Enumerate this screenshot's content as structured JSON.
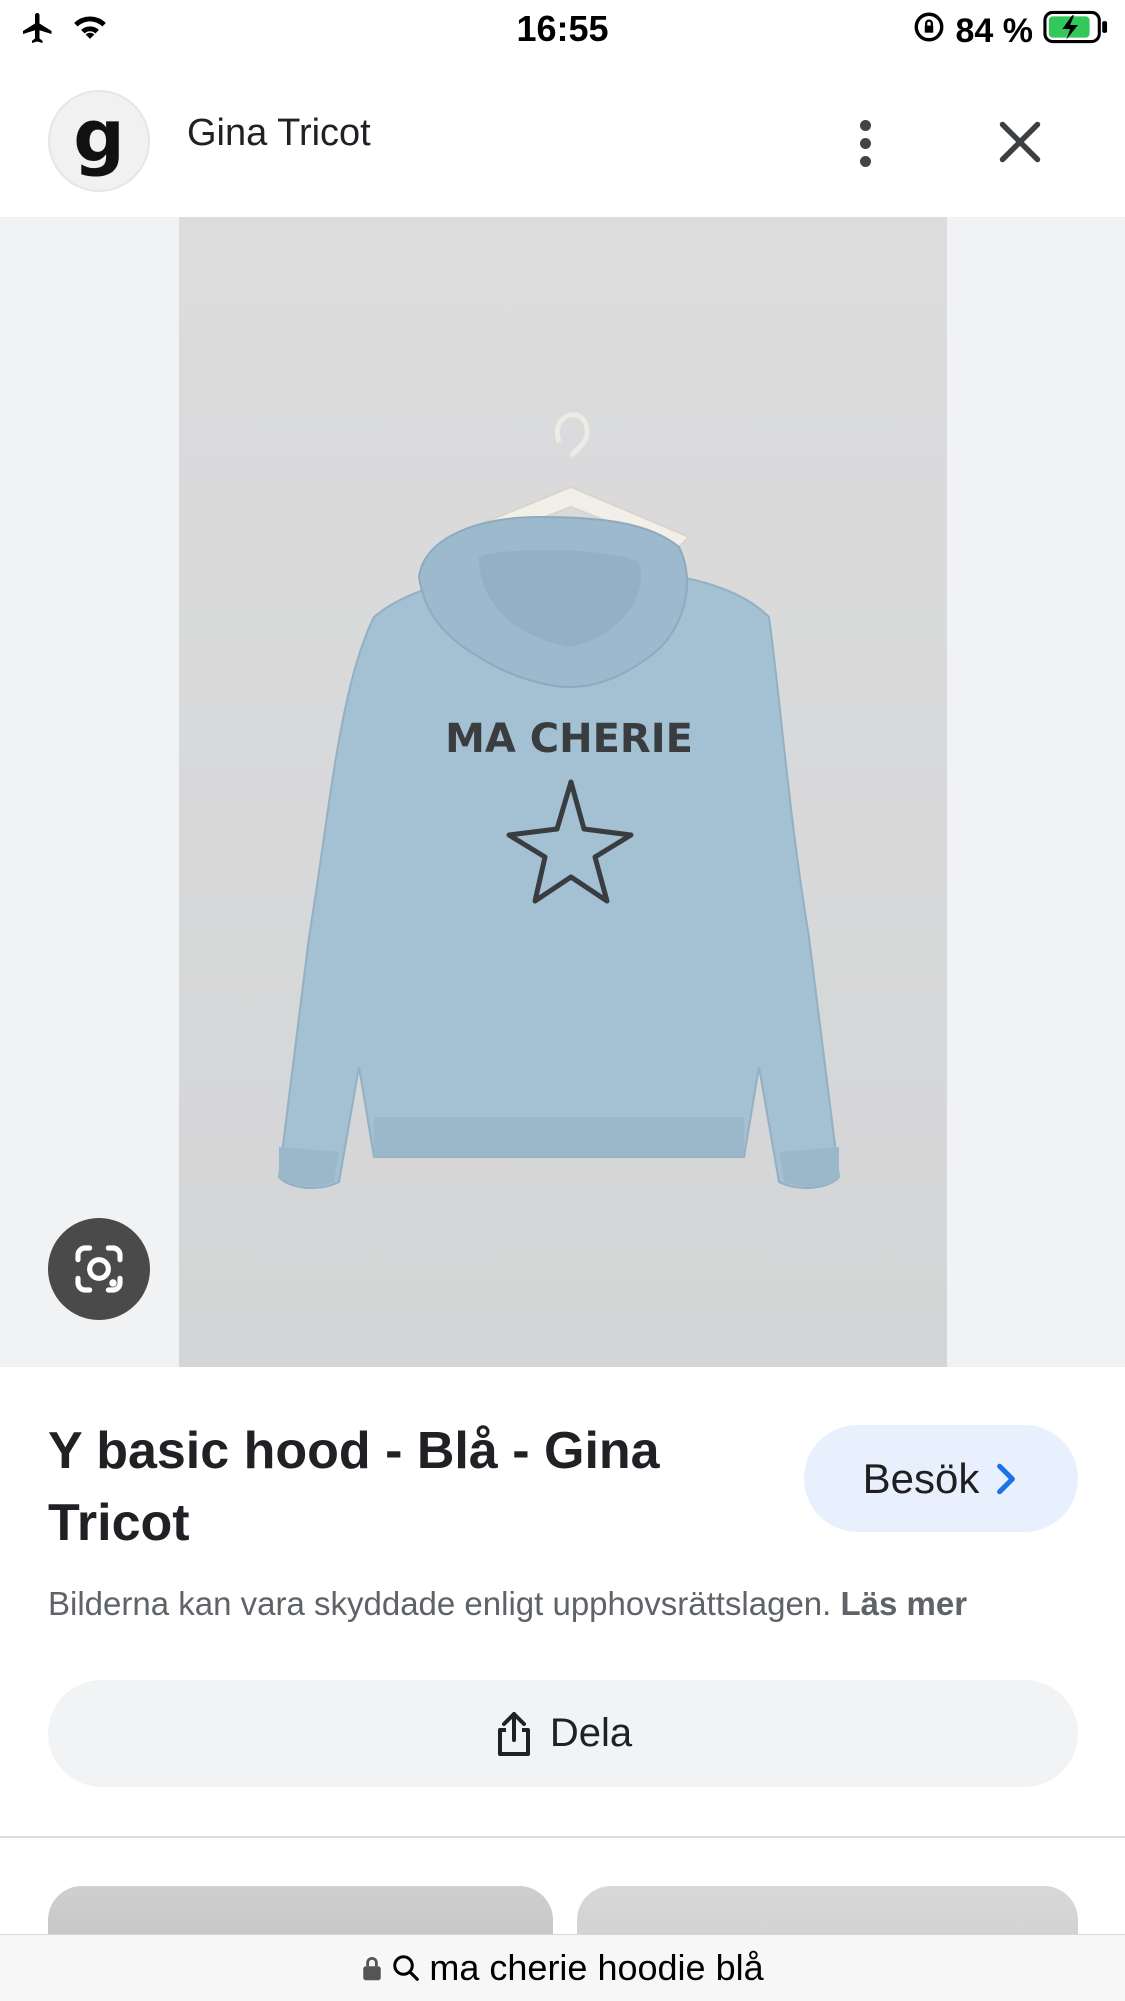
{
  "status_bar": {
    "time": "16:55",
    "battery": "84 %"
  },
  "header": {
    "logo_letter": "g",
    "site_name": "Gina Tricot"
  },
  "image": {
    "print_text": "MA CHERIE",
    "garment_color": "#a4c0d3"
  },
  "product": {
    "title": "Y basic hood - Blå - Gina Tricot",
    "visit_label": "Besök",
    "copyright_text": "Bilderna kan vara skyddade enligt upphovsrättslagen.",
    "read_more": "Läs mer",
    "share_label": "Dela"
  },
  "url_bar": {
    "query": "ma cherie hoodie blå"
  },
  "colors": {
    "accent": "#1a73e8",
    "visit_bg": "#e8f0fe",
    "battery_green": "#34c759"
  }
}
